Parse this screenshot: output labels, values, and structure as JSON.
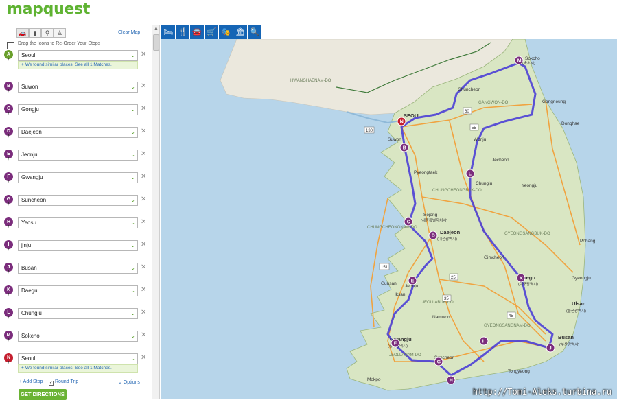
{
  "header": {
    "logo": "mapquest"
  },
  "sidebar": {
    "modes": [
      "car-icon",
      "bus-icon",
      "bike-icon",
      "walk-icon"
    ],
    "clear_map": "Clear Map",
    "hint": "Drag the Icons to Re-Order Your Stops",
    "stops": [
      {
        "letter": "A",
        "value": "Seoul",
        "color": "green",
        "similar": "We found similar places. See all 1 Matches."
      },
      {
        "letter": "B",
        "value": "Suwon",
        "color": "purple"
      },
      {
        "letter": "C",
        "value": "Gongju",
        "color": "purple"
      },
      {
        "letter": "D",
        "value": "Daejeon",
        "color": "purple"
      },
      {
        "letter": "E",
        "value": "Jeonju",
        "color": "purple"
      },
      {
        "letter": "F",
        "value": "Gwangju",
        "color": "purple"
      },
      {
        "letter": "G",
        "value": "Suncheon",
        "color": "purple"
      },
      {
        "letter": "H",
        "value": "Yeosu",
        "color": "purple"
      },
      {
        "letter": "I",
        "value": "jinju",
        "color": "purple"
      },
      {
        "letter": "J",
        "value": "Busan",
        "color": "purple"
      },
      {
        "letter": "K",
        "value": "Daegu",
        "color": "purple"
      },
      {
        "letter": "L",
        "value": "Chungju",
        "color": "purple"
      },
      {
        "letter": "M",
        "value": "Sokcho",
        "color": "purple"
      },
      {
        "letter": "N",
        "value": "Seoul",
        "color": "red",
        "similar": "We found similar places. See all 1 Matches."
      }
    ],
    "add_stop": "+ Add Stop",
    "round_trip": "Round Trip",
    "options": "Options",
    "get_directions": "GET DIRECTIONS"
  },
  "toolbar": [
    "hotel-icon",
    "restaurant-icon",
    "auto-icon",
    "shopping-icon",
    "entertainment-icon",
    "attractions-icon",
    "search-icon"
  ],
  "map": {
    "colors": {
      "sea": "#b7d5ea",
      "land": "#d9e6c3",
      "route": "#4b3fd6",
      "marker": "#7b2d7c",
      "road": "#f0a340",
      "north": "#ebe8dd"
    },
    "regions": [
      "HWANGHAENAM-DO",
      "GANGWON-DO",
      "CHUNGCHEONGBUK-DO",
      "CHUNGCHEONGNAM-DO",
      "JEOLLABUK-DO",
      "GYEONGSANGBUK-DO",
      "GYEONGSANGNAM-DO",
      "JEOLLANAM-DO"
    ],
    "cities": [
      {
        "name": "Sokcho",
        "sub": "(속초시)"
      },
      {
        "name": "Chuncheon"
      },
      {
        "name": "SEOUL"
      },
      {
        "name": "Gangneung"
      },
      {
        "name": "Donghae"
      },
      {
        "name": "Wonju"
      },
      {
        "name": "Suwon"
      },
      {
        "name": "Pyeongtaek"
      },
      {
        "name": "Chungju"
      },
      {
        "name": "Sejong",
        "sub": "(세종특별자치시)"
      },
      {
        "name": "Daejeon",
        "sub": "(대전광역시)"
      },
      {
        "name": "Gimcheon"
      },
      {
        "name": "Daegu",
        "sub": "(대구광역시)"
      },
      {
        "name": "Jeonju"
      },
      {
        "name": "Ulsan",
        "sub": "(울산광역시)"
      },
      {
        "name": "Gwangju",
        "sub": "(광주광역시)"
      },
      {
        "name": "Suncheon"
      },
      {
        "name": "Busan",
        "sub": "(부산광역시)"
      },
      {
        "name": "Yeongju"
      },
      {
        "name": "Pohang"
      },
      {
        "name": "Gunsan"
      },
      {
        "name": "Namwon"
      },
      {
        "name": "Mokpo"
      },
      {
        "name": "Gyeongju"
      },
      {
        "name": "Jecheon"
      },
      {
        "name": "Iksan"
      },
      {
        "name": "Tongyeong"
      }
    ],
    "route_labels": [
      "A",
      "B",
      "C",
      "D",
      "E",
      "F",
      "G",
      "H",
      "I",
      "J",
      "K",
      "L",
      "M",
      "N"
    ],
    "highways": [
      "130",
      "60",
      "55",
      "151",
      "35",
      "45",
      "25"
    ]
  },
  "watermark": "http://Tomi-Aleks.turbina.ru"
}
